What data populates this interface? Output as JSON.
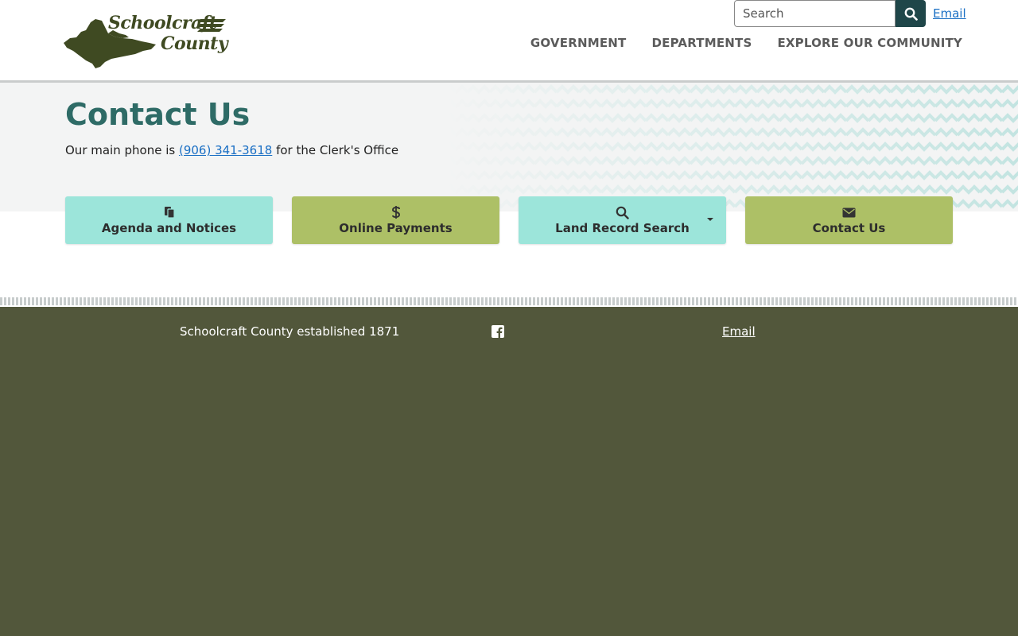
{
  "header": {
    "logo": {
      "line1": "Schoolcraft",
      "line2": "County"
    },
    "search": {
      "placeholder": "Search"
    },
    "email_link": "Email",
    "nav": [
      {
        "label": "GOVERNMENT"
      },
      {
        "label": "DEPARTMENTS"
      },
      {
        "label": "EXPLORE OUR COMMUNITY"
      }
    ]
  },
  "main": {
    "title": "Contact Us",
    "intro_prefix": "Our main phone is ",
    "phone": "(906) 341-3618",
    "intro_suffix": " for the Clerk's Office",
    "quick_links": [
      {
        "label": "Agenda and Notices",
        "icon": "copy-icon"
      },
      {
        "label": "Online Payments",
        "icon": "dollar-icon"
      },
      {
        "label": "Land Record Search",
        "icon": "search-icon"
      },
      {
        "label": "Contact Us",
        "icon": "envelope-icon"
      }
    ]
  },
  "footer": {
    "established": "Schoolcraft County established 1871",
    "social_icon": "facebook-icon",
    "email_link": "Email"
  },
  "colors": {
    "accent_dark": "#1f4649",
    "title": "#2e6b66",
    "teal_button": "#9ce5da",
    "green_button": "#adc066",
    "footer": "#52573b",
    "link": "#1a6fc4"
  }
}
